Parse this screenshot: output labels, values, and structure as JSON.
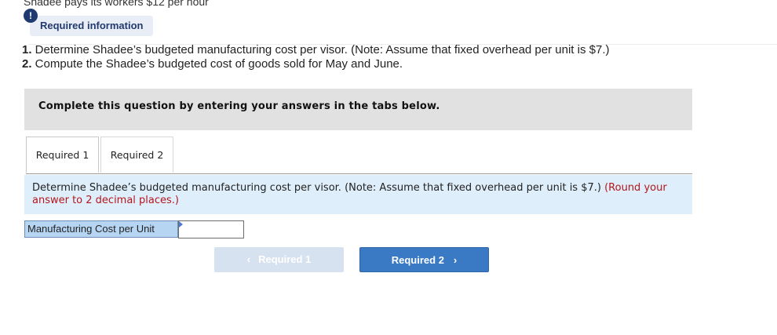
{
  "cut_off_text": "Shadee pays its workers $12 per hour",
  "alert_icon_glyph": "!",
  "required_info_label": "Required information",
  "instructions": [
    {
      "num": "1.",
      "text": " Determine Shadee’s budgeted manufacturing cost per visor. (Note: Assume that fixed overhead per unit is $7.)"
    },
    {
      "num": "2.",
      "text": " Compute the Shadee’s budgeted cost of goods sold for May and June."
    }
  ],
  "complete_prompt": "Complete this question by entering your answers in the tabs below.",
  "tabs": [
    {
      "label": "Required 1",
      "active": true
    },
    {
      "label": "Required 2",
      "active": false
    }
  ],
  "question": {
    "text": "Determine Shadee’s budgeted manufacturing cost per visor. (Note: Assume that fixed overhead per unit is $7.)",
    "note": "(Round your answer to 2 decimal places.)"
  },
  "answer": {
    "label": "Manufacturing Cost per Unit",
    "value": ""
  },
  "nav": {
    "prev_label": "Required 1",
    "next_label": "Required 2",
    "prev_icon": "chevron-left-icon",
    "next_icon": "chevron-right-icon"
  },
  "colors": {
    "accent": "#3a7ac4",
    "question_bg": "#dfeefb",
    "note_red": "#b5161b",
    "header_bg": "#e9eef6"
  }
}
